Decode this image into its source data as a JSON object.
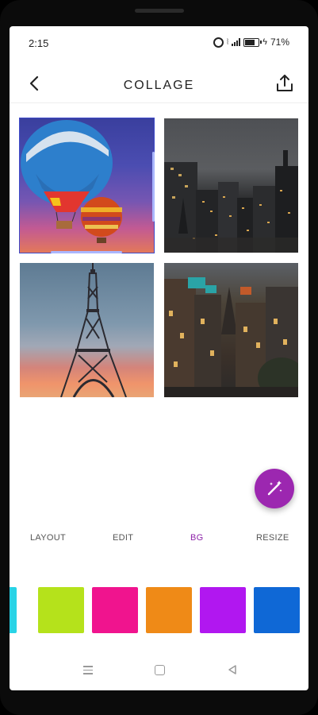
{
  "status_bar": {
    "time": "2:15",
    "battery": "71%"
  },
  "header": {
    "title": "COLLAGE"
  },
  "photos": [
    "Hot air balloons at sunset",
    "City skyline at dusk",
    "Eiffel Tower at sunset",
    "Old town buildings at dusk"
  ],
  "tabs": [
    {
      "label": "LAYOUT",
      "active": false
    },
    {
      "label": "EDIT",
      "active": false
    },
    {
      "label": "BG",
      "active": true
    },
    {
      "label": "RESIZE",
      "active": false
    }
  ],
  "colors": {
    "accent": "#9c27b0",
    "active_tab": "#8e24aa",
    "swatches": [
      "#29d3e6",
      "#b5e21b",
      "#f0148e",
      "#ef8a17",
      "#b117f0",
      "#0f68d6"
    ]
  },
  "icons": {
    "back": "chevron-left-icon",
    "share": "share-icon",
    "fab": "magic-wand-icon"
  }
}
